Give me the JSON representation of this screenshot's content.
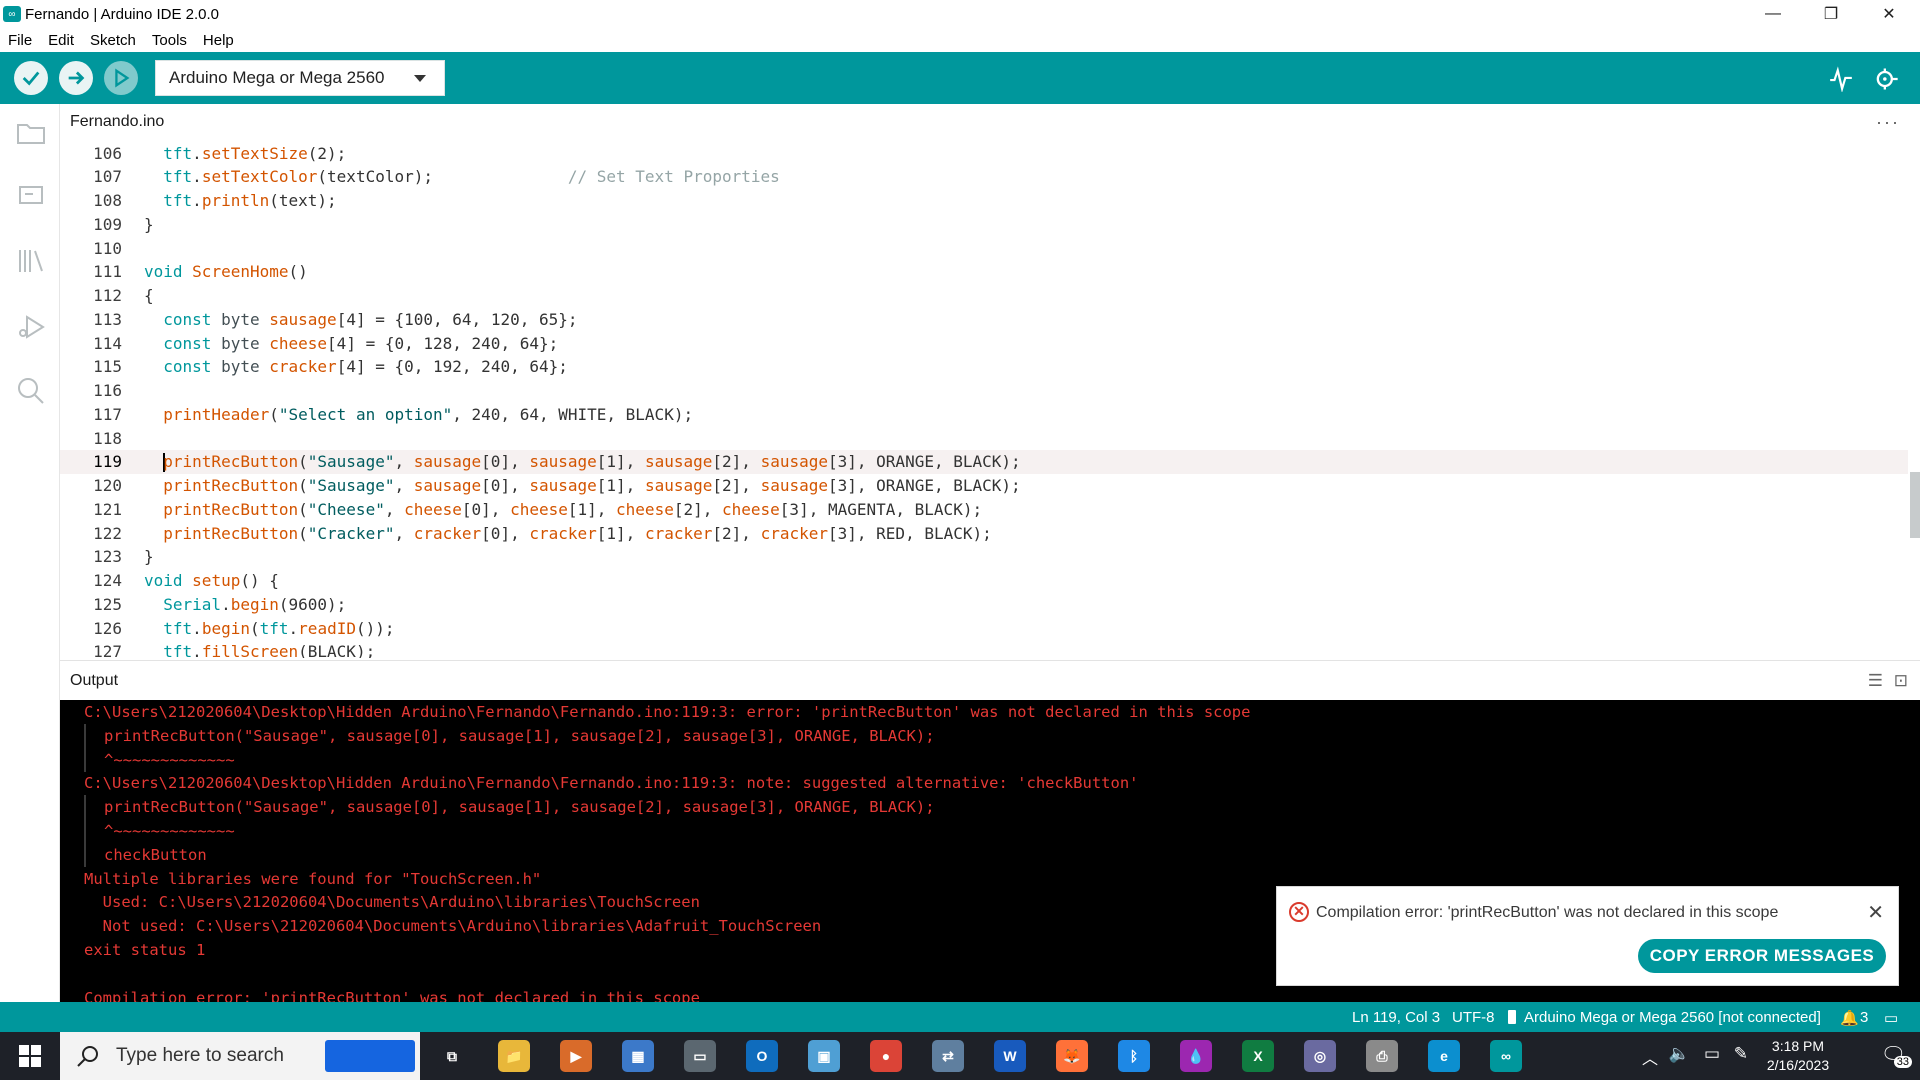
{
  "window": {
    "title": "Fernando | Arduino IDE 2.0.0",
    "icon_symbol": "∞",
    "min_symbol": "—",
    "restore_symbol": "❐",
    "close_symbol": "✕"
  },
  "menu": [
    "File",
    "Edit",
    "Sketch",
    "Tools",
    "Help"
  ],
  "toolbar": {
    "board": "Arduino Mega or Mega 2560",
    "accent": "#00979c"
  },
  "tabs": {
    "file": "Fernando.ino",
    "more": "···"
  },
  "editor": {
    "active_line": 119,
    "lines": [
      {
        "n": "106",
        "code": "  tft.setTextSize(2);"
      },
      {
        "n": "107",
        "code": "  tft.setTextColor(textColor);              // Set Text Proporties"
      },
      {
        "n": "108",
        "code": "  tft.println(text);"
      },
      {
        "n": "109",
        "code": "}"
      },
      {
        "n": "110",
        "code": ""
      },
      {
        "n": "111",
        "code": "void ScreenHome()"
      },
      {
        "n": "112",
        "code": "{"
      },
      {
        "n": "113",
        "code": "  const byte sausage[4] = {100, 64, 120, 65};"
      },
      {
        "n": "114",
        "code": "  const byte cheese[4] = {0, 128, 240, 64};"
      },
      {
        "n": "115",
        "code": "  const byte cracker[4] = {0, 192, 240, 64};"
      },
      {
        "n": "116",
        "code": ""
      },
      {
        "n": "117",
        "code": "  printHeader(\"Select an option\", 240, 64, WHITE, BLACK);"
      },
      {
        "n": "118",
        "code": ""
      },
      {
        "n": "119",
        "code": "  printRecButton(\"Sausage\", sausage[0], sausage[1], sausage[2], sausage[3], ORANGE, BLACK);"
      },
      {
        "n": "120",
        "code": "  printRecButton(\"Sausage\", sausage[0], sausage[1], sausage[2], sausage[3], ORANGE, BLACK);"
      },
      {
        "n": "121",
        "code": "  printRecButton(\"Cheese\", cheese[0], cheese[1], cheese[2], cheese[3], MAGENTA, BLACK);"
      },
      {
        "n": "122",
        "code": "  printRecButton(\"Cracker\", cracker[0], cracker[1], cracker[2], cracker[3], RED, BLACK);"
      },
      {
        "n": "123",
        "code": "}"
      },
      {
        "n": "124",
        "code": "void setup() {"
      },
      {
        "n": "125",
        "code": "  Serial.begin(9600);"
      },
      {
        "n": "126",
        "code": "  tft.begin(tft.readID());"
      },
      {
        "n": "127",
        "code": "  tft.fillScreen(BLACK);"
      }
    ]
  },
  "output": {
    "title": "Output",
    "actions": "☰ 🔓",
    "lines": [
      {
        "text": "C:\\Users\\212020604\\Desktop\\Hidden Arduino\\Fernando\\Fernando.ino:119:3: error: 'printRecButton' was not declared in this scope",
        "indent": 0
      },
      {
        "text": "printRecButton(\"Sausage\", sausage[0], sausage[1], sausage[2], sausage[3], ORANGE, BLACK);",
        "indent": 1
      },
      {
        "text": "^~~~~~~~~~~~~~",
        "indent": 1
      },
      {
        "text": "C:\\Users\\212020604\\Desktop\\Hidden Arduino\\Fernando\\Fernando.ino:119:3: note: suggested alternative: 'checkButton'",
        "indent": 0
      },
      {
        "text": "printRecButton(\"Sausage\", sausage[0], sausage[1], sausage[2], sausage[3], ORANGE, BLACK);",
        "indent": 1
      },
      {
        "text": "^~~~~~~~~~~~~~",
        "indent": 1
      },
      {
        "text": "checkButton",
        "indent": 1
      },
      {
        "text": "Multiple libraries were found for \"TouchScreen.h\"",
        "indent": 0
      },
      {
        "text": "  Used: C:\\Users\\212020604\\Documents\\Arduino\\libraries\\TouchScreen",
        "indent": 0
      },
      {
        "text": "  Not used: C:\\Users\\212020604\\Documents\\Arduino\\libraries\\Adafruit_TouchScreen",
        "indent": 0
      },
      {
        "text": "exit status 1",
        "indent": 0
      },
      {
        "text": "",
        "indent": 0
      },
      {
        "text": "Compilation error: 'printRecButton' was not declared in this scope",
        "indent": 0
      }
    ]
  },
  "notification": {
    "message": "Compilation error: 'printRecButton' was not declared in this scope",
    "button": "COPY ERROR MESSAGES",
    "close": "✕",
    "icon": "✕"
  },
  "status": {
    "position": "Ln 119, Col 3",
    "encoding": "UTF-8",
    "board": "Arduino Mega or Mega 2560 [not connected]",
    "notifications": "3"
  },
  "taskbar": {
    "search_placeholder": "Type here to search",
    "time": "3:18 PM",
    "date": "2/16/2023",
    "badge": "33",
    "apps": [
      {
        "name": "task-view",
        "label": "⧉",
        "color": "#1e2128"
      },
      {
        "name": "file-explorer",
        "label": "📁",
        "color": "#e8b73a"
      },
      {
        "name": "media-player",
        "label": "▶",
        "color": "#d96b2a"
      },
      {
        "name": "calculator",
        "label": "▦",
        "color": "#3c79c9"
      },
      {
        "name": "remote-desktop",
        "label": "▭",
        "color": "#5b6770"
      },
      {
        "name": "outlook",
        "label": "O",
        "color": "#0f6cbd"
      },
      {
        "name": "screen-app",
        "label": "▣",
        "color": "#4f9fd4"
      },
      {
        "name": "chrome",
        "label": "●",
        "color": "#db4437"
      },
      {
        "name": "network-app",
        "label": "⇄",
        "color": "#5f7f9f"
      },
      {
        "name": "word",
        "label": "W",
        "color": "#185abd"
      },
      {
        "name": "firefox",
        "label": "🦊",
        "color": "#ff7139"
      },
      {
        "name": "bluetooth",
        "label": "ᛒ",
        "color": "#1e88e5"
      },
      {
        "name": "paint-drop",
        "label": "💧",
        "color": "#9c27b0"
      },
      {
        "name": "excel",
        "label": "X",
        "color": "#107c41"
      },
      {
        "name": "disc-app",
        "label": "◎",
        "color": "#6a6aa0"
      },
      {
        "name": "printer-app",
        "label": "⎙",
        "color": "#8a8a8a"
      },
      {
        "name": "edge",
        "label": "e",
        "color": "#0c8fcf"
      },
      {
        "name": "arduino",
        "label": "∞",
        "color": "#00979c"
      }
    ]
  }
}
